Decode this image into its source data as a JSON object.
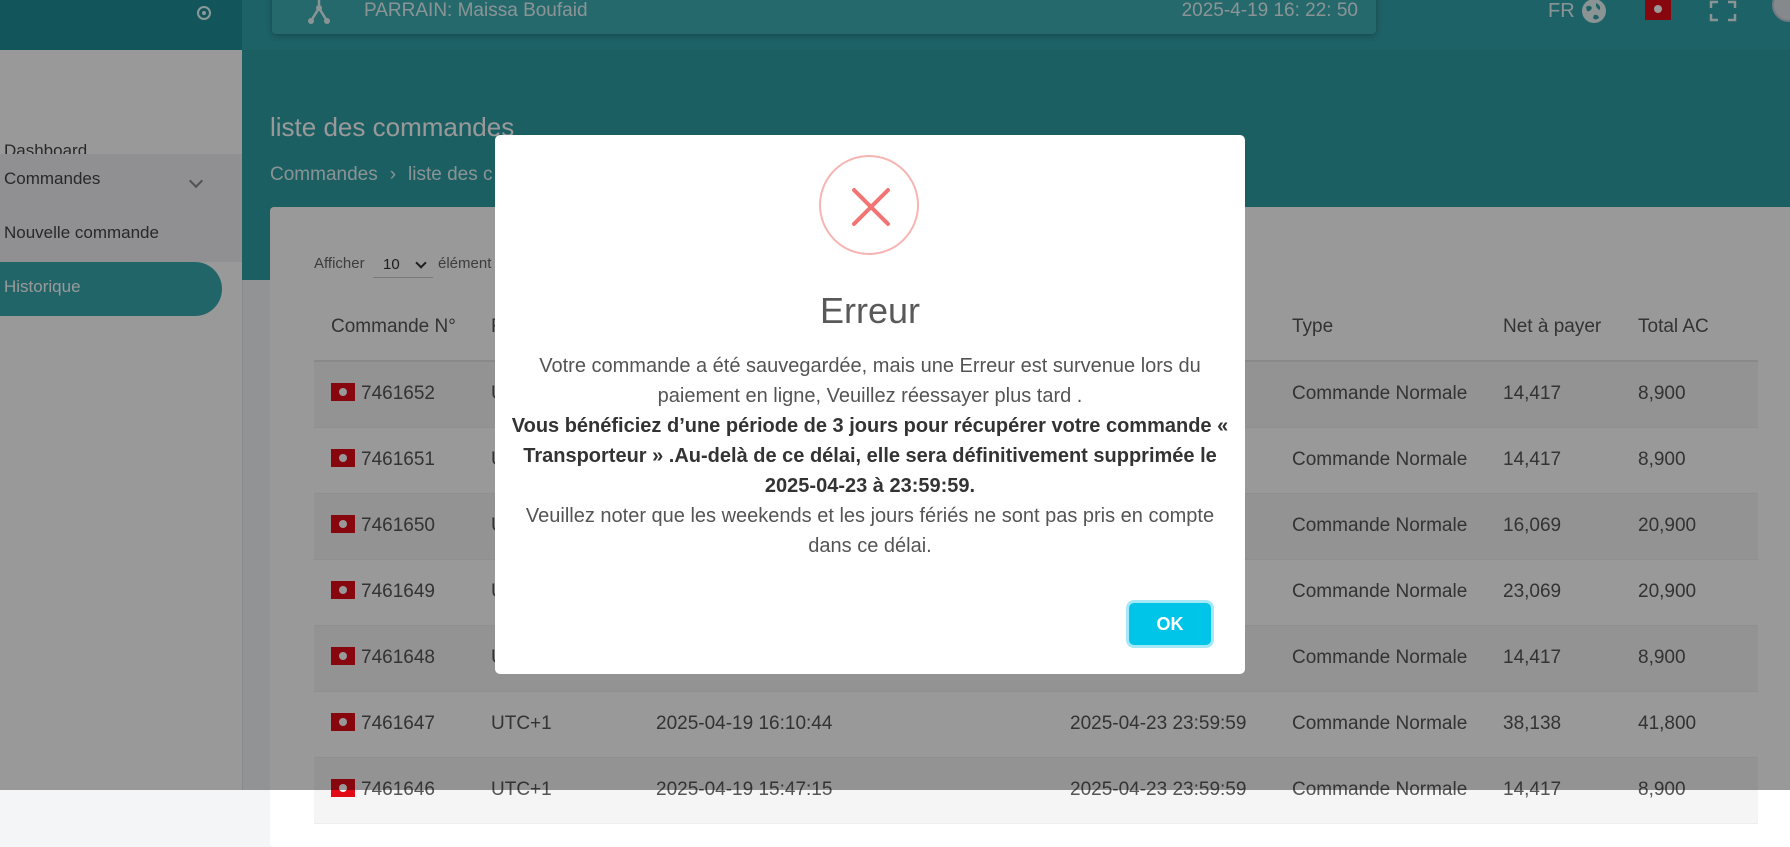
{
  "header": {
    "parrain": "PARRAIN: Maissa Boufaid",
    "datetime": "2025-4-19 16: 22: 50",
    "lang": "FR"
  },
  "sidebar": {
    "items": [
      {
        "label": "Dashboard"
      },
      {
        "label": "Commandes"
      },
      {
        "label": "Nouvelle commande"
      },
      {
        "label": "Historique"
      }
    ]
  },
  "page": {
    "title": "liste des commandes",
    "breadcrumb": [
      "Commandes",
      "liste des c"
    ]
  },
  "pagination": {
    "afficher": "Afficher",
    "page_size": "10",
    "elements": "élément"
  },
  "table": {
    "headers": {
      "commande": "Commande N°",
      "fuseau": "F",
      "date_livraison": "e",
      "type": "Type",
      "net": "Net à payer",
      "total": "Total AC"
    },
    "rows": [
      {
        "num": "7461652",
        "tz": "U",
        "date": "",
        "deadline": "9",
        "type": "Commande Normale",
        "net": "14,417",
        "total": "8,900"
      },
      {
        "num": "7461651",
        "tz": "U",
        "date": "",
        "deadline": "9",
        "type": "Commande Normale",
        "net": "14,417",
        "total": "8,900"
      },
      {
        "num": "7461650",
        "tz": "U",
        "date": "",
        "deadline": "9",
        "type": "Commande Normale",
        "net": "16,069",
        "total": "20,900"
      },
      {
        "num": "7461649",
        "tz": "U",
        "date": "",
        "deadline": "9",
        "type": "Commande Normale",
        "net": "23,069",
        "total": "20,900"
      },
      {
        "num": "7461648",
        "tz": "U",
        "date": "",
        "deadline": "9",
        "type": "Commande Normale",
        "net": "14,417",
        "total": "8,900"
      },
      {
        "num": "7461647",
        "tz": "UTC+1",
        "date": "2025-04-19 16:10:44",
        "deadline": "2025-04-23 23:59:59",
        "type": "Commande Normale",
        "net": "38,138",
        "total": "41,800"
      },
      {
        "num": "7461646",
        "tz": "UTC+1",
        "date": "2025-04-19 15:47:15",
        "deadline": "2025-04-23 23:59:59",
        "type": "Commande Normale",
        "net": "14,417",
        "total": "8,900"
      }
    ]
  },
  "modal": {
    "title": "Erreur",
    "line1": "Votre commande a été sauvegardée, mais une Erreur est survenue lors du paiement en ligne, Veuillez réessayer plus tard .",
    "line2": "Vous bénéficiez d’une période de 3 jours pour récupérer votre commande « Transporteur » .Au-delà de ce délai, elle sera définitivement supprimée le 2025-04-23 à 23:59:59.",
    "line3": "Veuillez noter que les weekends et les jours fériés ne sont pas pris en compte dans ce délai.",
    "ok_label": "OK"
  },
  "colors": {
    "teal": "#2f9fa6",
    "error_red": "#f27474",
    "ok_button": "#00c4e8"
  }
}
